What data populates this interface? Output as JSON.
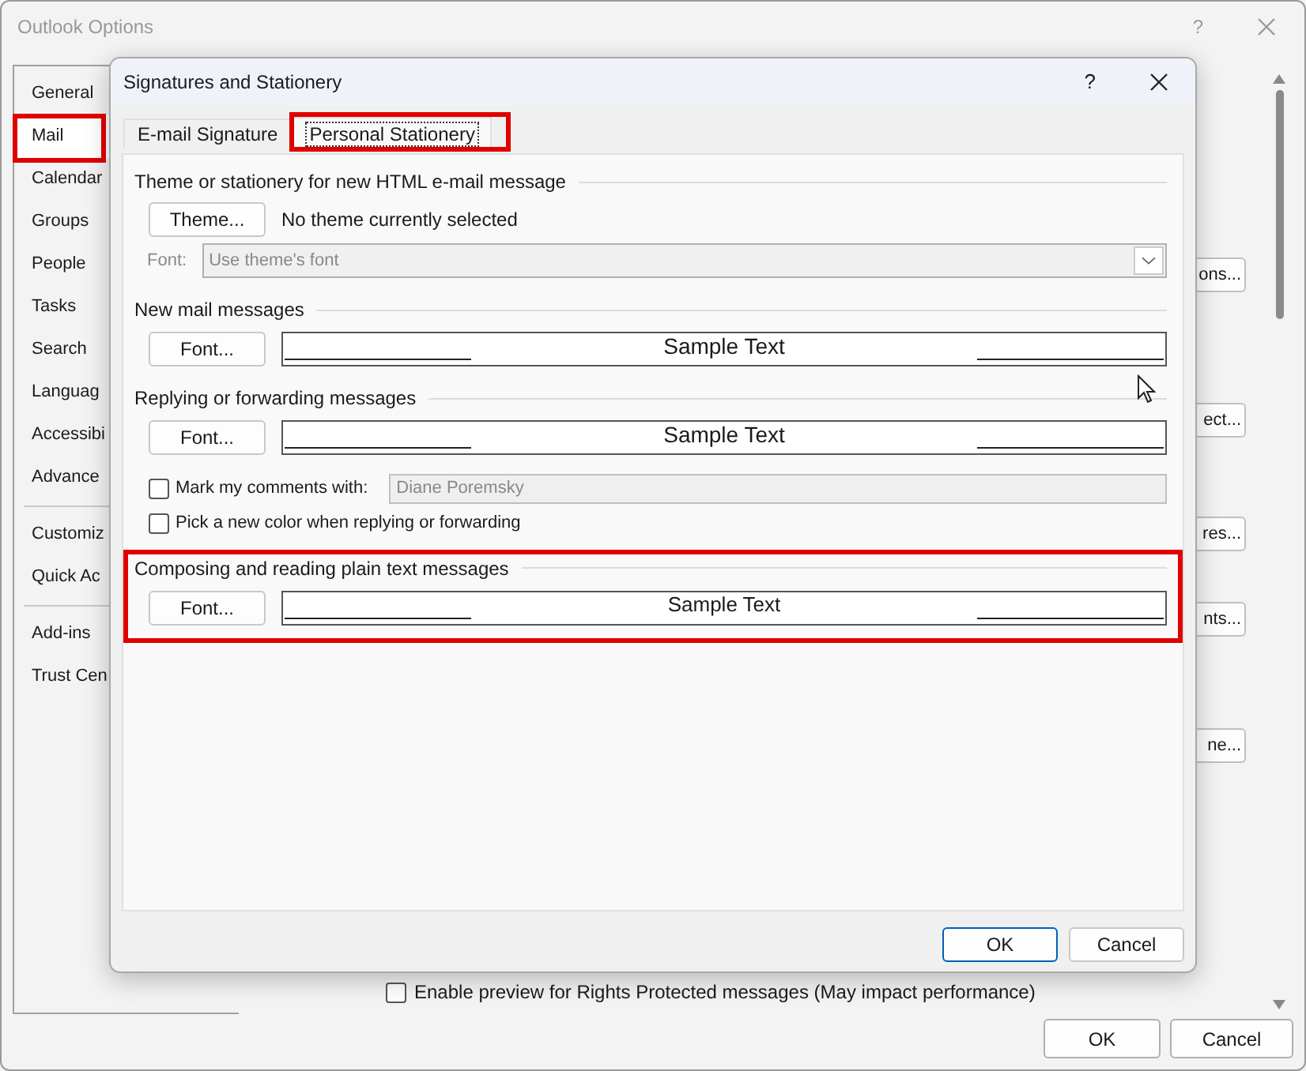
{
  "window": {
    "title": "Outlook Options",
    "help": "?"
  },
  "sidebar": {
    "items": [
      {
        "label": "General",
        "selected": false,
        "highlighted": false
      },
      {
        "label": "Mail",
        "selected": true,
        "highlighted": true
      },
      {
        "label": "Calendar",
        "selected": false,
        "highlighted": false
      },
      {
        "label": "Groups",
        "selected": false,
        "highlighted": false
      },
      {
        "label": "People",
        "selected": false,
        "highlighted": false
      },
      {
        "label": "Tasks",
        "selected": false,
        "highlighted": false
      },
      {
        "label": "Search",
        "selected": false,
        "highlighted": false
      },
      {
        "label": "Languag",
        "selected": false,
        "highlighted": false
      },
      {
        "label": "Accessibi",
        "selected": false,
        "highlighted": false
      },
      {
        "label": "Advance",
        "selected": false,
        "highlighted": false,
        "divider_after": true
      },
      {
        "label": "Customiz",
        "selected": false,
        "highlighted": false
      },
      {
        "label": "Quick Ac",
        "selected": false,
        "highlighted": false,
        "divider_after": true
      },
      {
        "label": "Add-ins",
        "selected": false,
        "highlighted": false
      },
      {
        "label": "Trust Cen",
        "selected": false,
        "highlighted": false
      }
    ]
  },
  "background_buttons": [
    "ons...",
    "ect...",
    "res...",
    "nts...",
    "ne..."
  ],
  "background_option": {
    "label": "Enable preview for Rights Protected messages (May impact performance)",
    "checked": false
  },
  "buttons": [
    "OK",
    "Cancel"
  ],
  "dialog": {
    "title": "Signatures and Stationery",
    "help": "?",
    "tabs": [
      {
        "label": "E-mail Signature",
        "selected": false,
        "highlighted": false
      },
      {
        "label": "Personal Stationery",
        "selected": true,
        "highlighted": true
      }
    ],
    "sections": [
      {
        "kind": "theme",
        "title": "Theme or stationery for new HTML e-mail message",
        "button": "Theme...",
        "status": "No theme currently selected",
        "font_label": "Font:",
        "font_value": "Use theme's font",
        "highlighted": false
      },
      {
        "kind": "font",
        "title": "New mail messages",
        "button": "Font...",
        "sample": "Sample Text",
        "highlighted": false
      },
      {
        "kind": "font",
        "title": "Replying or forwarding messages",
        "button": "Font...",
        "sample": "Sample Text",
        "highlighted": false,
        "options": [
          {
            "kind": "checkbox_field",
            "label": "Mark my comments with:",
            "checked": false,
            "value": "Diane Poremsky"
          },
          {
            "kind": "checkbox",
            "label": "Pick a new color when replying or forwarding",
            "checked": false
          }
        ]
      },
      {
        "kind": "font",
        "title": "Composing and reading plain text messages",
        "button": "Font...",
        "sample": "Sample Text",
        "highlighted": true
      }
    ],
    "buttons": [
      {
        "label": "OK",
        "default": true
      },
      {
        "label": "Cancel",
        "default": false
      }
    ]
  }
}
